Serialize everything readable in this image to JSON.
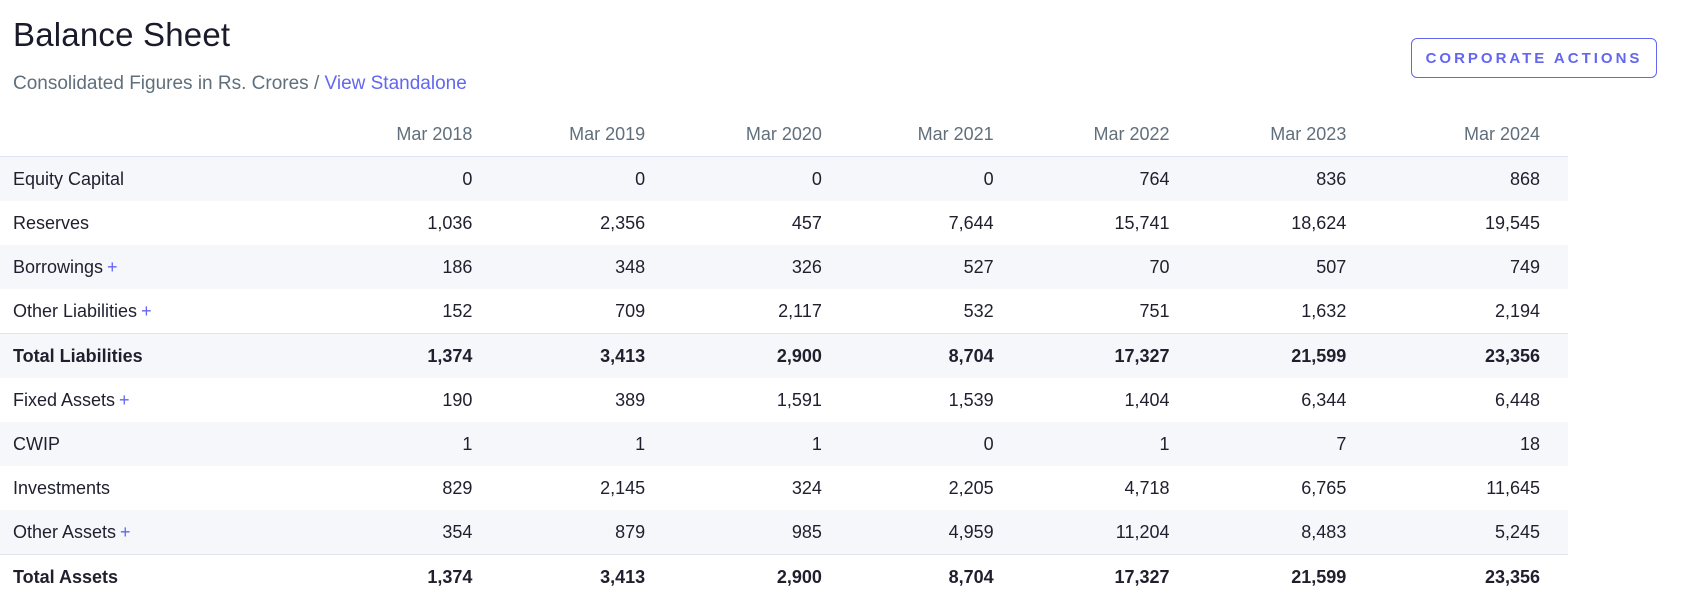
{
  "header": {
    "title": "Balance Sheet",
    "subtitle": "Consolidated Figures in Rs. Crores / ",
    "standalone_link": "View Standalone",
    "action_button": "CORPORATE ACTIONS"
  },
  "colors": {
    "accent": "#6366f1",
    "alt_row_bg": "#f6f7fb",
    "border": "#dfe5ef",
    "muted_text": "#606f7b"
  },
  "table": {
    "columns": [
      "Mar 2018",
      "Mar 2019",
      "Mar 2020",
      "Mar 2021",
      "Mar 2022",
      "Mar 2023",
      "Mar 2024"
    ],
    "rows": [
      {
        "label": "Equity Capital",
        "expandable": false,
        "total": false,
        "values": [
          "0",
          "0",
          "0",
          "0",
          "764",
          "836",
          "868"
        ]
      },
      {
        "label": "Reserves",
        "expandable": false,
        "total": false,
        "values": [
          "1,036",
          "2,356",
          "457",
          "7,644",
          "15,741",
          "18,624",
          "19,545"
        ]
      },
      {
        "label": "Borrowings",
        "expandable": true,
        "total": false,
        "values": [
          "186",
          "348",
          "326",
          "527",
          "70",
          "507",
          "749"
        ]
      },
      {
        "label": "Other Liabilities",
        "expandable": true,
        "total": false,
        "values": [
          "152",
          "709",
          "2,117",
          "532",
          "751",
          "1,632",
          "2,194"
        ]
      },
      {
        "label": "Total Liabilities",
        "expandable": false,
        "total": true,
        "values": [
          "1,374",
          "3,413",
          "2,900",
          "8,704",
          "17,327",
          "21,599",
          "23,356"
        ]
      },
      {
        "label": "Fixed Assets",
        "expandable": true,
        "total": false,
        "values": [
          "190",
          "389",
          "1,591",
          "1,539",
          "1,404",
          "6,344",
          "6,448"
        ]
      },
      {
        "label": "CWIP",
        "expandable": false,
        "total": false,
        "values": [
          "1",
          "1",
          "1",
          "0",
          "1",
          "7",
          "18"
        ]
      },
      {
        "label": "Investments",
        "expandable": false,
        "total": false,
        "values": [
          "829",
          "2,145",
          "324",
          "2,205",
          "4,718",
          "6,765",
          "11,645"
        ]
      },
      {
        "label": "Other Assets",
        "expandable": true,
        "total": false,
        "values": [
          "354",
          "879",
          "985",
          "4,959",
          "11,204",
          "8,483",
          "5,245"
        ]
      },
      {
        "label": "Total Assets",
        "expandable": false,
        "total": true,
        "values": [
          "1,374",
          "3,413",
          "2,900",
          "8,704",
          "17,327",
          "21,599",
          "23,356"
        ]
      }
    ],
    "expand_symbol": "+"
  }
}
